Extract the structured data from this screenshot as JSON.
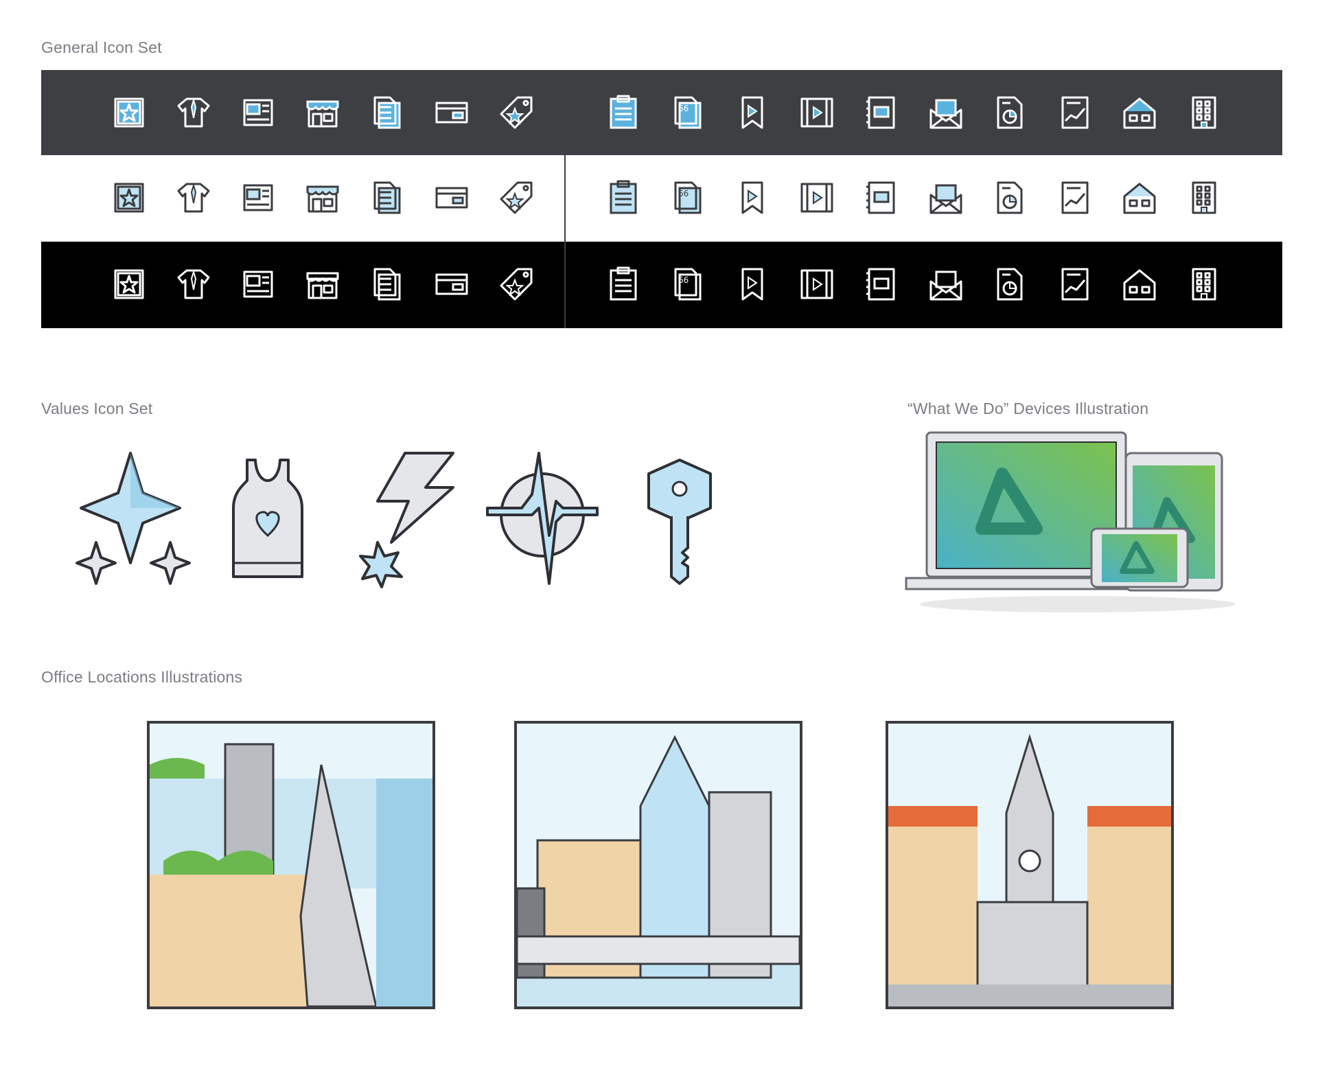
{
  "sections": {
    "general_title": "General Icon Set",
    "values_title": "Values Icon Set",
    "devices_title": "“What We Do” Devices Illustration",
    "offices_title": "Office Locations Illustrations"
  },
  "general_icons": {
    "left_group": [
      "star-frame-icon",
      "shirt-tie-icon",
      "newspaper-icon",
      "storefront-icon",
      "documents-icon",
      "credit-card-icon",
      "price-tag-star-icon"
    ],
    "right_group": [
      "clipboard-icon",
      "quote-document-icon",
      "bookmark-play-icon",
      "film-play-icon",
      "notebook-icon",
      "envelope-icon",
      "pie-chart-document-icon",
      "chart-document-icon",
      "house-icon",
      "office-building-icon"
    ],
    "row_themes": [
      "dark",
      "light",
      "black"
    ],
    "colors": {
      "dark_row": "#3e3f43",
      "light_row": "#ffffff",
      "black_row": "#000000",
      "accent": "#5bb2dd",
      "accent_light": "#bfe3f4"
    }
  },
  "values_icons": [
    "sparkle-stars-icon",
    "tank-top-heart-icon",
    "lightning-burst-icon",
    "heartbeat-compass-icon",
    "key-icon"
  ],
  "devices": {
    "items": [
      "laptop",
      "tablet",
      "phone"
    ],
    "logo": "triangle-logo-icon",
    "colors": {
      "screen_start": "#4ab1c8",
      "screen_end": "#7cc24e",
      "logo": "#2d8a6f"
    }
  },
  "offices": [
    "city-illustration-san-francisco",
    "city-illustration-montreal",
    "city-illustration-european-town-hall"
  ]
}
